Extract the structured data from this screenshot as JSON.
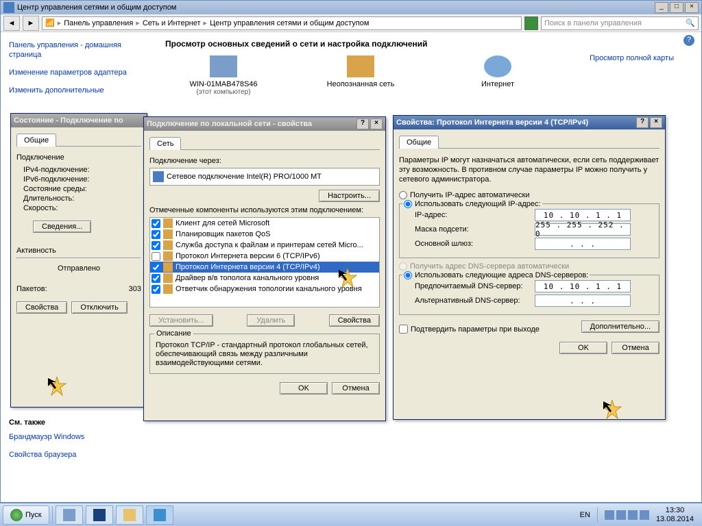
{
  "window": {
    "title": "Центр управления сетями и общим доступом",
    "breadcrumbs": [
      "Панель управления",
      "Сеть и Интернет",
      "Центр управления сетями и общим доступом"
    ],
    "search_placeholder": "Поиск в панели управления"
  },
  "sidebar": {
    "links": [
      "Панель управления - домашняя страница",
      "Изменение параметров адаптера",
      "Изменить дополнительные"
    ],
    "see_also_heading": "См. также",
    "see_also": [
      "Брандмауэр Windows",
      "Свойства браузера"
    ]
  },
  "main": {
    "heading": "Просмотр основных сведений о сети и настройка подключений",
    "right_link": "Просмотр полной карты",
    "nodes": [
      {
        "name": "WIN-01MAB478S46",
        "sub": "(этот компьютер)"
      },
      {
        "name": "Неопознанная сеть",
        "sub": ""
      },
      {
        "name": "Интернет",
        "sub": ""
      }
    ]
  },
  "status_dlg": {
    "title": "Состояние - Подключение по",
    "tab": "Общие",
    "conn_heading": "Подключение",
    "rows": [
      {
        "l": "IPv4-подключение:",
        "v": ""
      },
      {
        "l": "IPv6-подключение:",
        "v": ""
      },
      {
        "l": "Состояние среды:",
        "v": ""
      },
      {
        "l": "Длительность:",
        "v": ""
      },
      {
        "l": "Скорость:",
        "v": ""
      }
    ],
    "details_btn": "Сведения...",
    "activity_heading": "Активность",
    "sent_label": "Отправлено",
    "packets_label": "Пакетов:",
    "packets_value": "303",
    "props_btn": "Свойства",
    "disable_btn": "Отключить"
  },
  "props_dlg": {
    "title": "Подключение по локальной сети - свойства",
    "tab": "Сеть",
    "conn_via_label": "Подключение через:",
    "adapter": "Сетевое подключение Intel(R) PRO/1000 MT",
    "configure_btn": "Настроить...",
    "components_label": "Отмеченные компоненты используются этим подключением:",
    "components": [
      {
        "chk": true,
        "txt": "Клиент для сетей Microsoft"
      },
      {
        "chk": true,
        "txt": "Планировщик пакетов QoS"
      },
      {
        "chk": true,
        "txt": "Служба доступа к файлам и принтерам сетей Micro..."
      },
      {
        "chk": false,
        "txt": "Протокол Интернета версии 6 (TCP/IPv6)"
      },
      {
        "chk": true,
        "txt": "Протокол Интернета версии 4 (TCP/IPv4)",
        "sel": true
      },
      {
        "chk": true,
        "txt": "Драйвер в/в тополога канального уровня"
      },
      {
        "chk": true,
        "txt": "Ответчик обнаружения топологии канального уровня"
      }
    ],
    "install_btn": "Установить...",
    "remove_btn": "Удалить",
    "props_btn": "Свойства",
    "desc_heading": "Описание",
    "desc_text": "Протокол TCP/IP - стандартный протокол глобальных сетей, обеспечивающий связь между различными взаимодействующими сетями.",
    "ok": "OK",
    "cancel": "Отмена"
  },
  "tcpip_dlg": {
    "title": "Свойства: Протокол Интернета версии 4 (TCP/IPv4)",
    "tab": "Общие",
    "intro": "Параметры IP могут назначаться автоматически, если сеть поддерживает эту возможность. В противном случае параметры IP можно получить у сетевого администратора.",
    "auto_ip": "Получить IP-адрес автоматически",
    "manual_ip": "Использовать следующий IP-адрес:",
    "ip_label": "IP-адрес:",
    "ip_value": "10 . 10 .  1 .  1",
    "mask_label": "Маска подсети:",
    "mask_value": "255 . 255 . 252 .  0",
    "gw_label": "Основной шлюз:",
    "gw_value": " .       .       . ",
    "auto_dns": "Получить адрес DNS-сервера автоматически",
    "manual_dns": "Использовать следующие адреса DNS-серверов:",
    "dns1_label": "Предпочитаемый DNS-сервер:",
    "dns1_value": "10 . 10 .  1 .  1",
    "dns2_label": "Альтернативный DNS-сервер:",
    "dns2_value": " .       .       . ",
    "confirm_chk": "Подтвердить параметры при выходе",
    "advanced_btn": "Дополнительно...",
    "ok": "OK",
    "cancel": "Отмена"
  },
  "taskbar": {
    "start": "Пуск",
    "lang": "EN",
    "time": "13:30",
    "date": "13.08.2014"
  }
}
